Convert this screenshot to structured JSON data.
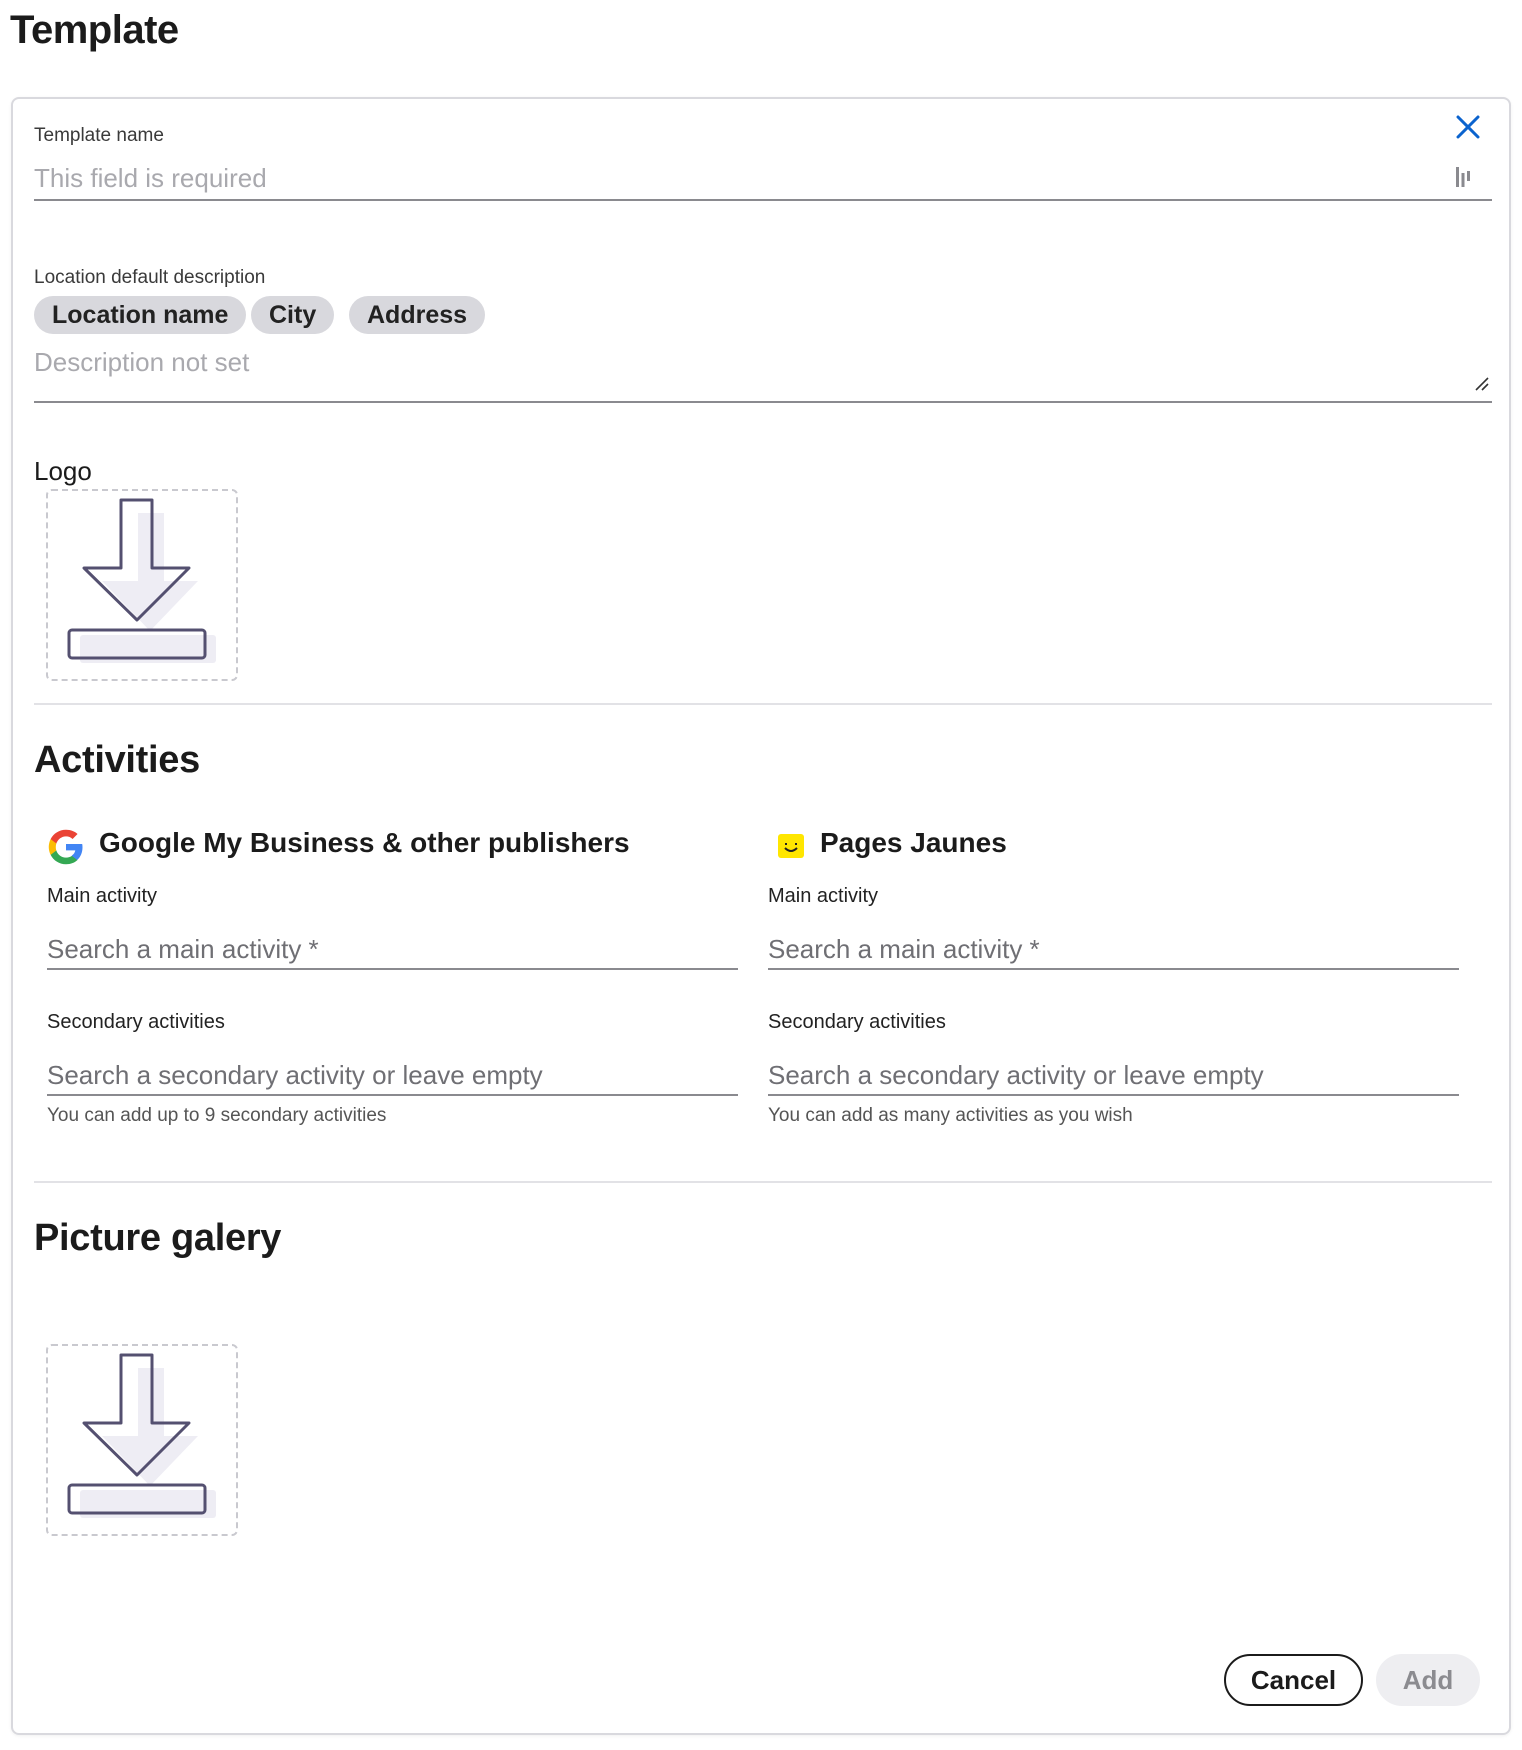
{
  "page": {
    "title": "Template"
  },
  "form": {
    "template_name": {
      "label": "Template name",
      "placeholder": "This field is required"
    },
    "description": {
      "label": "Location default description",
      "chips": [
        "Location name",
        "City",
        "Address"
      ],
      "placeholder": "Description not set"
    },
    "logo": {
      "label": "Logo"
    }
  },
  "activities": {
    "title": "Activities",
    "google": {
      "title": "Google My Business & other publishers",
      "icon": "google-icon",
      "main_label": "Main activity",
      "main_placeholder": "Search a main activity *",
      "secondary_label": "Secondary activities",
      "secondary_placeholder": "Search a secondary activity or leave empty",
      "helper": "You can add up to 9 secondary activities"
    },
    "pages_jaunes": {
      "title": "Pages Jaunes",
      "icon": "pages-jaunes-icon",
      "main_label": "Main activity",
      "main_placeholder": "Search a main activity *",
      "secondary_label": "Secondary activities",
      "secondary_placeholder": "Search a secondary activity or leave empty",
      "helper": "You can add as many activities as you wish"
    }
  },
  "gallery": {
    "title": "Picture galery"
  },
  "actions": {
    "cancel": "Cancel",
    "add": "Add"
  },
  "colors": {
    "accent": "#0b63ce",
    "chip_bg": "#d8d8dd",
    "pages_jaunes_yellow": "#ffe600",
    "upload_icon_stroke": "#545070"
  }
}
